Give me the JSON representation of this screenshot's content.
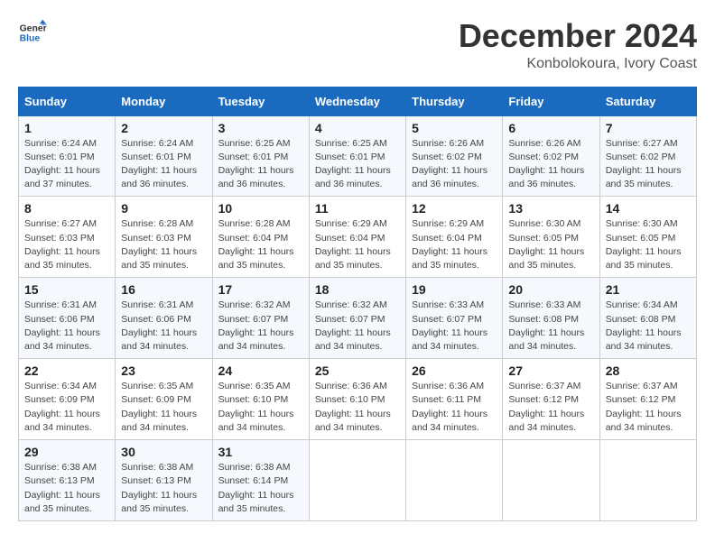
{
  "logo": {
    "line1": "General",
    "line2": "Blue"
  },
  "title": "December 2024",
  "subtitle": "Konbolokoura, Ivory Coast",
  "weekdays": [
    "Sunday",
    "Monday",
    "Tuesday",
    "Wednesday",
    "Thursday",
    "Friday",
    "Saturday"
  ],
  "weeks": [
    [
      {
        "day": "1",
        "sunrise": "6:24 AM",
        "sunset": "6:01 PM",
        "daylight": "11 hours and 37 minutes."
      },
      {
        "day": "2",
        "sunrise": "6:24 AM",
        "sunset": "6:01 PM",
        "daylight": "11 hours and 36 minutes."
      },
      {
        "day": "3",
        "sunrise": "6:25 AM",
        "sunset": "6:01 PM",
        "daylight": "11 hours and 36 minutes."
      },
      {
        "day": "4",
        "sunrise": "6:25 AM",
        "sunset": "6:01 PM",
        "daylight": "11 hours and 36 minutes."
      },
      {
        "day": "5",
        "sunrise": "6:26 AM",
        "sunset": "6:02 PM",
        "daylight": "11 hours and 36 minutes."
      },
      {
        "day": "6",
        "sunrise": "6:26 AM",
        "sunset": "6:02 PM",
        "daylight": "11 hours and 36 minutes."
      },
      {
        "day": "7",
        "sunrise": "6:27 AM",
        "sunset": "6:02 PM",
        "daylight": "11 hours and 35 minutes."
      }
    ],
    [
      {
        "day": "8",
        "sunrise": "6:27 AM",
        "sunset": "6:03 PM",
        "daylight": "11 hours and 35 minutes."
      },
      {
        "day": "9",
        "sunrise": "6:28 AM",
        "sunset": "6:03 PM",
        "daylight": "11 hours and 35 minutes."
      },
      {
        "day": "10",
        "sunrise": "6:28 AM",
        "sunset": "6:04 PM",
        "daylight": "11 hours and 35 minutes."
      },
      {
        "day": "11",
        "sunrise": "6:29 AM",
        "sunset": "6:04 PM",
        "daylight": "11 hours and 35 minutes."
      },
      {
        "day": "12",
        "sunrise": "6:29 AM",
        "sunset": "6:04 PM",
        "daylight": "11 hours and 35 minutes."
      },
      {
        "day": "13",
        "sunrise": "6:30 AM",
        "sunset": "6:05 PM",
        "daylight": "11 hours and 35 minutes."
      },
      {
        "day": "14",
        "sunrise": "6:30 AM",
        "sunset": "6:05 PM",
        "daylight": "11 hours and 35 minutes."
      }
    ],
    [
      {
        "day": "15",
        "sunrise": "6:31 AM",
        "sunset": "6:06 PM",
        "daylight": "11 hours and 34 minutes."
      },
      {
        "day": "16",
        "sunrise": "6:31 AM",
        "sunset": "6:06 PM",
        "daylight": "11 hours and 34 minutes."
      },
      {
        "day": "17",
        "sunrise": "6:32 AM",
        "sunset": "6:07 PM",
        "daylight": "11 hours and 34 minutes."
      },
      {
        "day": "18",
        "sunrise": "6:32 AM",
        "sunset": "6:07 PM",
        "daylight": "11 hours and 34 minutes."
      },
      {
        "day": "19",
        "sunrise": "6:33 AM",
        "sunset": "6:07 PM",
        "daylight": "11 hours and 34 minutes."
      },
      {
        "day": "20",
        "sunrise": "6:33 AM",
        "sunset": "6:08 PM",
        "daylight": "11 hours and 34 minutes."
      },
      {
        "day": "21",
        "sunrise": "6:34 AM",
        "sunset": "6:08 PM",
        "daylight": "11 hours and 34 minutes."
      }
    ],
    [
      {
        "day": "22",
        "sunrise": "6:34 AM",
        "sunset": "6:09 PM",
        "daylight": "11 hours and 34 minutes."
      },
      {
        "day": "23",
        "sunrise": "6:35 AM",
        "sunset": "6:09 PM",
        "daylight": "11 hours and 34 minutes."
      },
      {
        "day": "24",
        "sunrise": "6:35 AM",
        "sunset": "6:10 PM",
        "daylight": "11 hours and 34 minutes."
      },
      {
        "day": "25",
        "sunrise": "6:36 AM",
        "sunset": "6:10 PM",
        "daylight": "11 hours and 34 minutes."
      },
      {
        "day": "26",
        "sunrise": "6:36 AM",
        "sunset": "6:11 PM",
        "daylight": "11 hours and 34 minutes."
      },
      {
        "day": "27",
        "sunrise": "6:37 AM",
        "sunset": "6:12 PM",
        "daylight": "11 hours and 34 minutes."
      },
      {
        "day": "28",
        "sunrise": "6:37 AM",
        "sunset": "6:12 PM",
        "daylight": "11 hours and 34 minutes."
      }
    ],
    [
      {
        "day": "29",
        "sunrise": "6:38 AM",
        "sunset": "6:13 PM",
        "daylight": "11 hours and 35 minutes."
      },
      {
        "day": "30",
        "sunrise": "6:38 AM",
        "sunset": "6:13 PM",
        "daylight": "11 hours and 35 minutes."
      },
      {
        "day": "31",
        "sunrise": "6:38 AM",
        "sunset": "6:14 PM",
        "daylight": "11 hours and 35 minutes."
      },
      null,
      null,
      null,
      null
    ]
  ],
  "labels": {
    "sunrise": "Sunrise: ",
    "sunset": "Sunset: ",
    "daylight": "Daylight: "
  }
}
